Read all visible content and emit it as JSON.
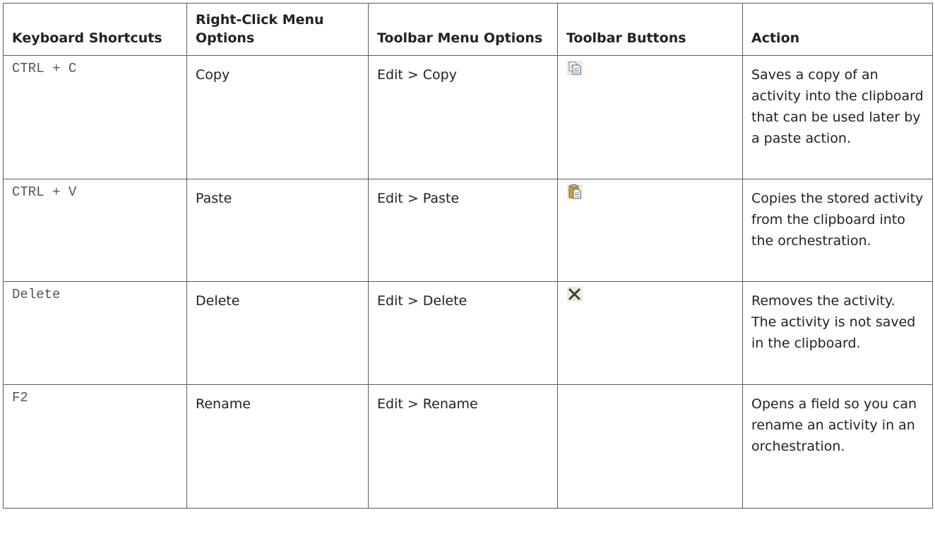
{
  "table": {
    "headers": {
      "shortcuts": "Keyboard Shortcuts",
      "right_click": "Right-Click Menu Options",
      "toolbar_menu": "Toolbar Menu Options",
      "toolbar_buttons": "Toolbar Buttons",
      "action": "Action"
    },
    "rows": [
      {
        "shortcut": "CTRL + C",
        "right_click": "Copy",
        "toolbar_menu": "Edit > Copy",
        "toolbar_button_icon": "copy-icon",
        "action": "Saves a copy of an activity into the clipboard that can be used later by a paste action."
      },
      {
        "shortcut": "CTRL + V",
        "right_click": "Paste",
        "toolbar_menu": "Edit > Paste",
        "toolbar_button_icon": "paste-icon",
        "action": "Copies the stored activity from the clipboard into the orchestration."
      },
      {
        "shortcut": "Delete",
        "right_click": "Delete",
        "toolbar_menu": "Edit > Delete",
        "toolbar_button_icon": "delete-icon",
        "action": "Removes the activity. The activity is not saved in the clipboard."
      },
      {
        "shortcut": "F2",
        "right_click": "Rename",
        "toolbar_menu": "Edit > Rename",
        "toolbar_button_icon": "",
        "action": "Opens a field so you can rename an activity in an orchestration."
      }
    ]
  }
}
